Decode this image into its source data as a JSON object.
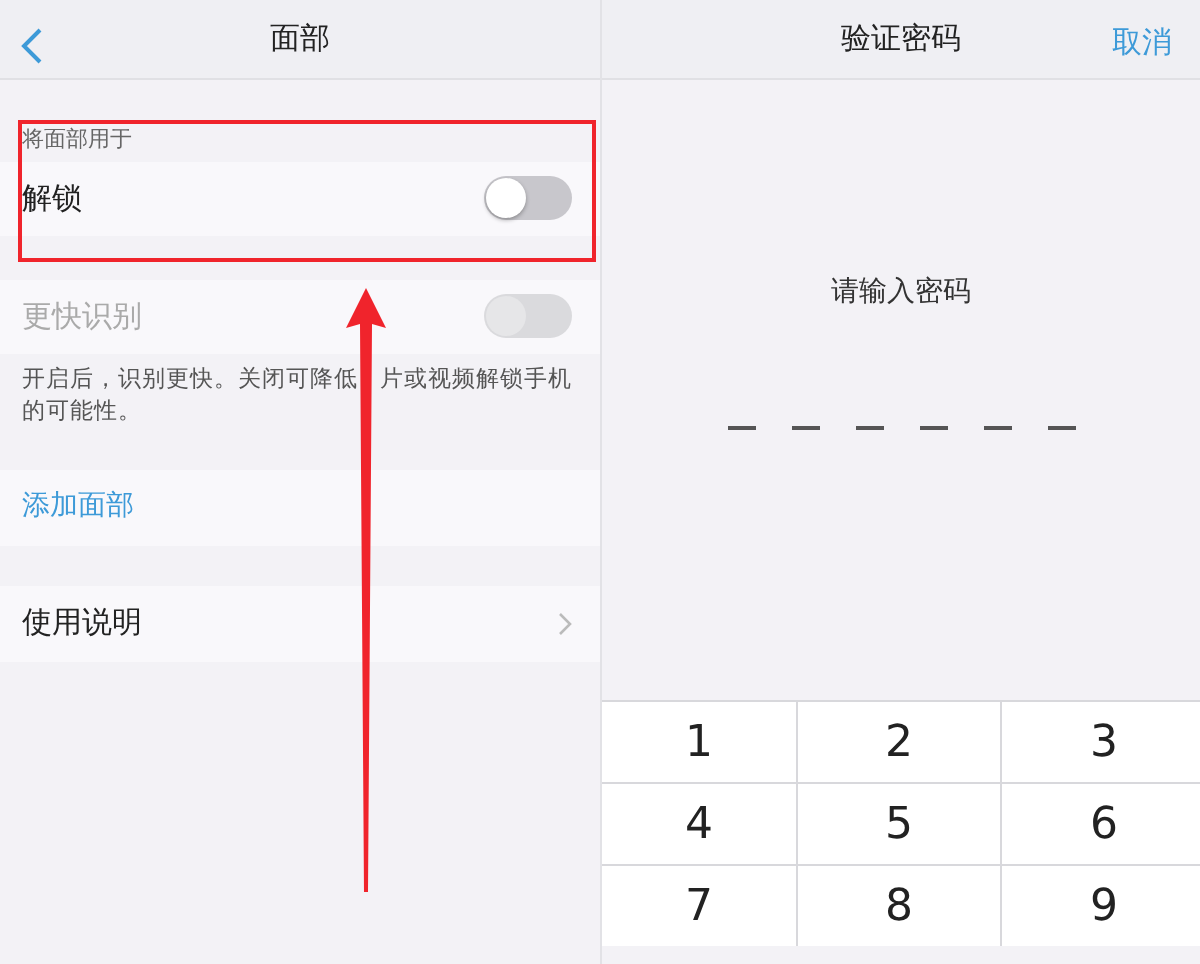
{
  "face_settings": {
    "title": "面部",
    "section_label": "将面部用于",
    "toggles": [
      {
        "label": "解锁",
        "on": false,
        "disabled": false
      },
      {
        "label": "更快识别",
        "on": false,
        "disabled": true
      }
    ],
    "description": [
      "开启后，识别更快。关闭可降低",
      "片或视频解锁手机",
      "的可能性。"
    ],
    "add_face": "添加面部",
    "instructions": "使用说明"
  },
  "verify_passcode": {
    "title": "验证密码",
    "cancel": "取消",
    "prompt": "请输入密码",
    "slots": [
      {
        "filled": false
      },
      {
        "filled": false
      },
      {
        "filled": false
      },
      {
        "filled": false
      },
      {
        "filled": false
      },
      {
        "filled": false
      }
    ],
    "keys": [
      "1",
      "2",
      "3",
      "4",
      "5",
      "6",
      "7",
      "8",
      "9"
    ]
  }
}
